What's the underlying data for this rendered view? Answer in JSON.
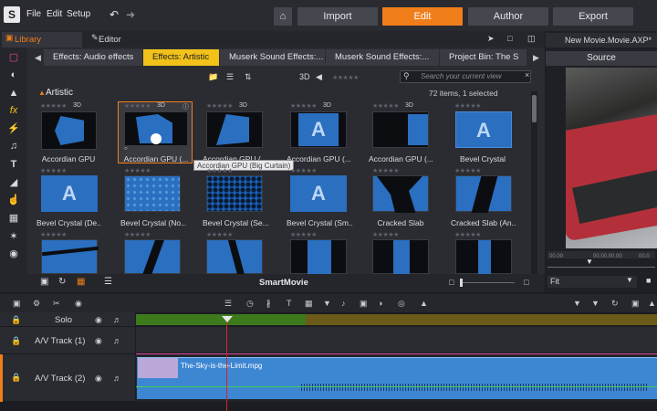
{
  "app": {
    "menu": [
      "File",
      "Edit",
      "Setup"
    ],
    "nav": [
      {
        "label": "Import",
        "active": false
      },
      {
        "label": "Edit",
        "active": true
      },
      {
        "label": "Author",
        "active": false
      },
      {
        "label": "Export",
        "active": false
      }
    ]
  },
  "panels": {
    "library_label": "Library",
    "editor_label": "Editor"
  },
  "library": {
    "tabs": [
      {
        "label": "Effects: Audio effects",
        "active": false
      },
      {
        "label": "Effects: Artistic",
        "active": true
      },
      {
        "label": "Muserk Sound Effects:...",
        "active": false
      },
      {
        "label": "Muserk Sound Effects:...",
        "active": false
      },
      {
        "label": "Project Bin: The S",
        "active": false
      }
    ],
    "view_3d": "3D",
    "search_placeholder": "Search your current view",
    "section_title": "Artistic",
    "items_count": "72 items, 1 selected",
    "tooltip": "Accordian GPU (Big Curtain)",
    "row1": [
      {
        "label": "Accordian GPU",
        "badge": "3D"
      },
      {
        "label": "Accordian GPU (...",
        "badge": "3D"
      },
      {
        "label": "Accordian GPU (...",
        "badge": "3D"
      },
      {
        "label": "Accordian GPU (...",
        "badge": "3D"
      },
      {
        "label": "Accordian GPU (...",
        "badge": "3D"
      },
      {
        "label": "Bevel Crystal",
        "badge": ""
      }
    ],
    "row2": [
      {
        "label": "Bevel Crystal (De...",
        "badge": ""
      },
      {
        "label": "Bevel Crystal (No...",
        "badge": ""
      },
      {
        "label": "Bevel Crystal (Se...",
        "badge": ""
      },
      {
        "label": "Bevel Crystal (Sm...",
        "badge": ""
      },
      {
        "label": "Cracked Slab",
        "badge": ""
      },
      {
        "label": "Cracked Slab (An...",
        "badge": ""
      }
    ],
    "bottom_label": "SmartMovie"
  },
  "source": {
    "movie_title": "New Movie.Movie.AXP*",
    "label": "Source",
    "timecode_a": "00.00",
    "timecode_b": "00.00.00.00",
    "timecode_c": "00.0",
    "fit": "Fit"
  },
  "timeline": {
    "tracks": [
      {
        "name": "Solo"
      },
      {
        "name": "A/V Track (1)"
      },
      {
        "name": "A/V Track (2)"
      }
    ],
    "clip_name": "The-Sky-is-the-Limit.mpg"
  },
  "colors": {
    "accent": "#f07e1b",
    "active_tab": "#f2c21a",
    "clip": "#3d86d2",
    "playhead": "#d8232a"
  }
}
